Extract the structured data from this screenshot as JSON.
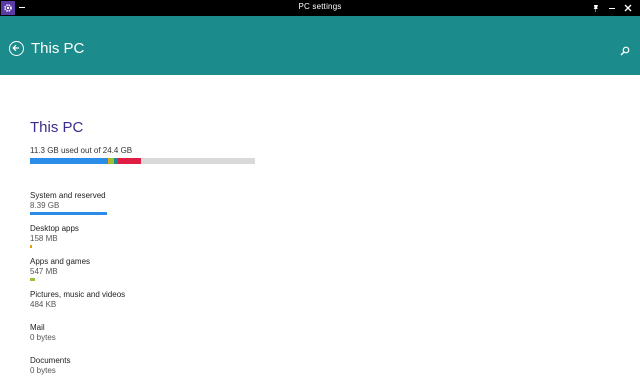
{
  "window": {
    "title": "PC settings",
    "icon": "gear-icon",
    "controls": [
      "pin-icon",
      "minimize-icon",
      "close-icon"
    ]
  },
  "header": {
    "title": "This PC",
    "back_icon": "back-arrow-icon",
    "search_icon": "search-icon",
    "color": "#1b8b8b"
  },
  "main": {
    "title": "This PC",
    "usage_text": "11.3 GB used out of 24.4 GB",
    "total_bar": {
      "background": "#d9d9d9",
      "segments": [
        {
          "color": "#2b8de8",
          "fraction": 0.348
        },
        {
          "color": "#e5a10f",
          "fraction": 0.005
        },
        {
          "color": "#9cc038",
          "fraction": 0.022
        },
        {
          "color": "#1b8b8b",
          "fraction": 0.019
        },
        {
          "color": "#e01d45",
          "fraction": 0.1
        }
      ]
    },
    "categories": [
      {
        "label": "System and reserved",
        "size": "8.39 GB",
        "color": "#2b8de8",
        "fraction": 0.344
      },
      {
        "label": "Desktop apps",
        "size": "158 MB",
        "color": "#e5a10f",
        "fraction": 0.006
      },
      {
        "label": "Apps and games",
        "size": "547 MB",
        "color": "#9cc038",
        "fraction": 0.022
      },
      {
        "label": "Pictures, music and videos",
        "size": "484 KB",
        "color": "#1b8b8b",
        "fraction": 0
      },
      {
        "label": "Mail",
        "size": "0 bytes",
        "color": "#1b8b8b",
        "fraction": 0
      },
      {
        "label": "Documents",
        "size": "0 bytes",
        "color": "#1b8b8b",
        "fraction": 0
      }
    ]
  }
}
